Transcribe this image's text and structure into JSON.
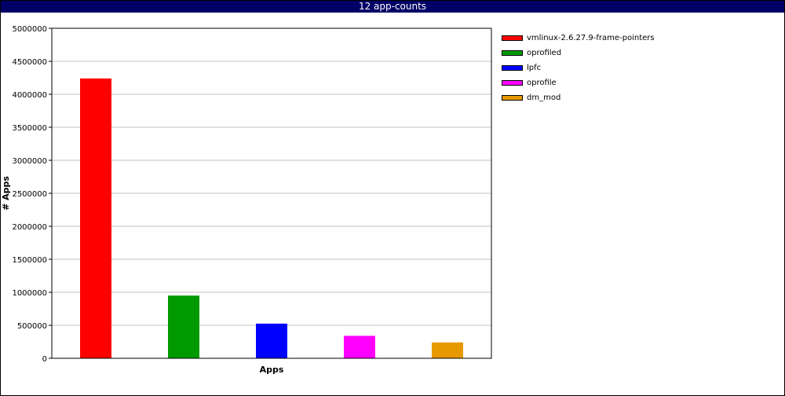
{
  "window": {
    "title": "12 app-counts"
  },
  "chart_data": {
    "type": "bar",
    "xlabel": "Apps",
    "ylabel": "# Apps",
    "ylim": [
      0,
      5000000
    ],
    "yticks": [
      0,
      500000,
      1000000,
      1500000,
      2000000,
      2500000,
      3000000,
      3500000,
      4000000,
      4500000,
      5000000
    ],
    "ytick_labels": [
      "0",
      "500000",
      "1000000",
      "1500000",
      "2000000",
      "2500000",
      "3000000",
      "3500000",
      "4000000",
      "4500000",
      "5000000"
    ],
    "grid": true,
    "legend_position": "right",
    "categories": [
      "vmlinux-2.6.27.9-frame-pointers",
      "oprofiled",
      "lpfc",
      "oprofile",
      "dm_mod"
    ],
    "values": [
      4240000,
      950000,
      525000,
      340000,
      240000
    ],
    "colors": [
      "#ff0000",
      "#009900",
      "#0000ff",
      "#ff00ff",
      "#e69900"
    ]
  }
}
